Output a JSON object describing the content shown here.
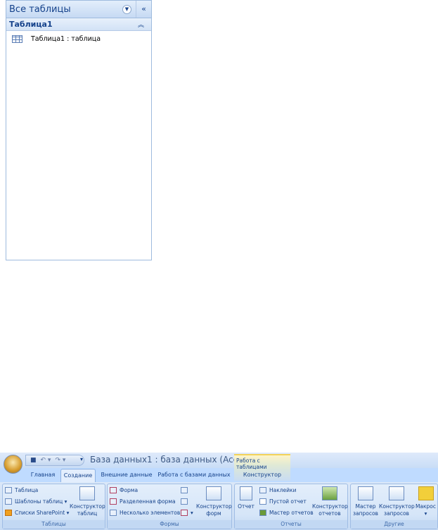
{
  "nav": {
    "header": "Все таблицы",
    "group": "Таблица1",
    "items": [
      {
        "label": "Таблица1 : таблица"
      }
    ]
  },
  "ribbon": {
    "title": "База данных1 : база данных (Acc...",
    "contextual": "Работа с таблицами",
    "tabs": [
      "Главная",
      "Создание",
      "Внешние данные",
      "Работа с базами данных",
      "Конструктор"
    ],
    "active_tab": "Создание",
    "groups": {
      "tables": {
        "label": "Таблицы",
        "items": [
          "Таблица",
          "Шаблоны таблиц",
          "Списки SharePoint"
        ],
        "big": [
          "Конструктор",
          "таблиц"
        ]
      },
      "forms": {
        "label": "Формы",
        "items": [
          "Форма",
          "Разделенная форма",
          "Несколько элементов"
        ],
        "big": [
          "Конструктор",
          "форм"
        ]
      },
      "reports": {
        "label": "Отчеты",
        "report": "Отчет",
        "items": [
          "Наклейки",
          "Пустой отчет",
          "Мастер отчетов"
        ],
        "big": [
          "Конструктор",
          "отчетов"
        ]
      },
      "other": {
        "label": "Другие",
        "wizard": [
          "Мастер",
          "запросов"
        ],
        "designer": [
          "Конструктор",
          "запросов"
        ],
        "macro": "Макрос"
      }
    }
  }
}
